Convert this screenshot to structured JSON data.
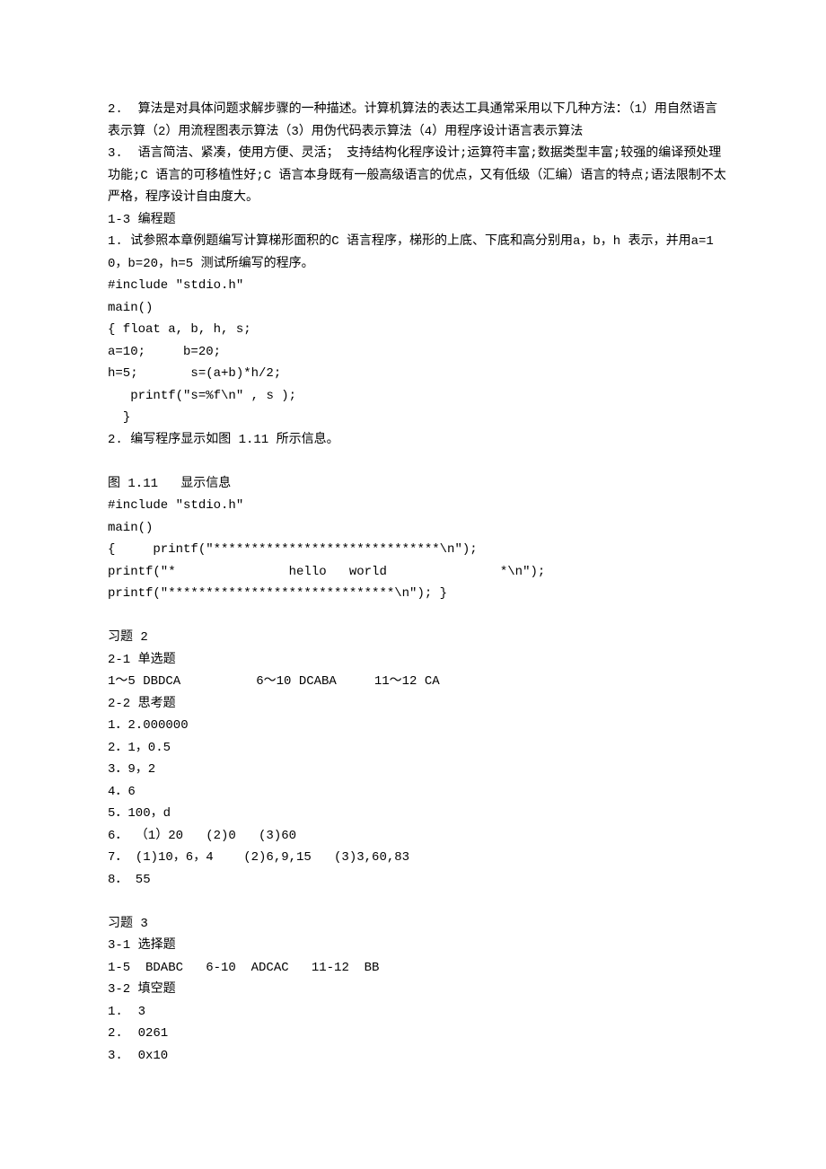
{
  "lines": {
    "l01": "2.  算法是对具体问题求解步骤的一种描述。计算机算法的表达工具通常采用以下几种方法：（1）用自然语言表示算（2）用流程图表示算法（3）用伪代码表示算法（4）用程序设计语言表示算法",
    "l02": "3.  语言简洁、紧凑，使用方便、灵活； 支持结构化程序设计;运算符丰富;数据类型丰富;较强的编译预处理功能;C 语言的可移植性好;C 语言本身既有一般高级语言的优点，又有低级（汇编）语言的特点;语法限制不太严格，程序设计自由度大。",
    "l03": "1-3 编程题",
    "l04": "1. 试参照本章例题编写计算梯形面积的C 语言程序，梯形的上底、下底和高分别用a，b，h 表示，并用a=10，b=20，h=5 测试所编写的程序。",
    "l05": "#include \"stdio.h\"",
    "l06": "main()",
    "l07": "{ float a, b, h, s;",
    "l08": "a=10;     b=20;",
    "l09": "h=5;       s=(a+b)*h/2;",
    "l10": "   printf(\"s=%f\\n\" , s );",
    "l11": "  }",
    "l12": "2. 编写程序显示如图 1.11 所示信息。",
    "l13": "图 1.11   显示信息",
    "l14": "#include \"stdio.h\"",
    "l15": "main()",
    "l16": "{     printf(\"******************************\\n\");",
    "l17": "printf(\"*               hello   world               *\\n\");",
    "l18": "printf(\"******************************\\n\"); }",
    "l19": "习题 2",
    "l20": "2-1 单选题",
    "l21": "1～5 DBDCA          6～10 DCABA     11～12 CA",
    "l22": "2-2 思考题",
    "l23": "1．2.000000",
    "l24": "2．1，0.5",
    "l25": "3．9，2",
    "l26": "4．6",
    "l27": "5．100，d",
    "l28": "6． （1）20   (2)0   (3)60",
    "l29": "7． (1)10，6，4    (2)6,9,15   (3)3,60,83",
    "l30": "8． 55",
    "l31": "习题 3",
    "l32": "3-1 选择题",
    "l33": "1-5  BDABC   6-10  ADCAC   11-12  BB",
    "l34": "3-2 填空题",
    "l35": "1.  3",
    "l36": "2.  0261",
    "l37": "3.  0x10"
  }
}
